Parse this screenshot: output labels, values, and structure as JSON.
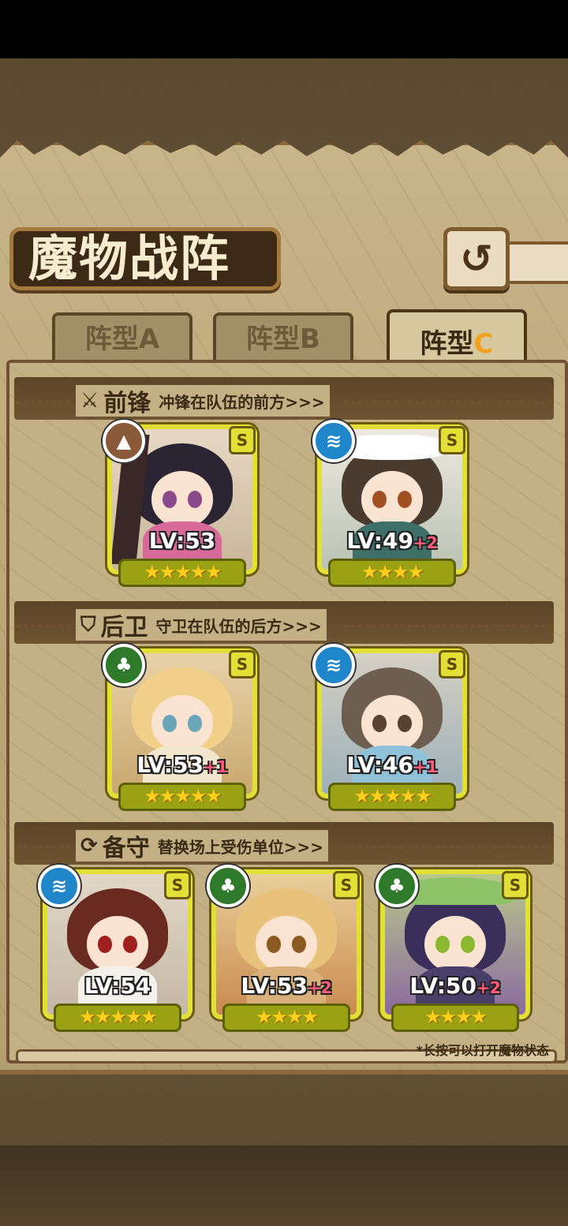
{
  "title": "魔物战阵",
  "back_icon": "↺",
  "tabs": [
    {
      "label": "阵型A",
      "active": false
    },
    {
      "label": "阵型B",
      "active": false
    },
    {
      "label": "阵型",
      "accent": "C",
      "active": true
    }
  ],
  "sections": {
    "front": {
      "name": "前锋",
      "desc": "冲锋在队伍的前方>>>",
      "icon": "sword-icon"
    },
    "back": {
      "name": "后卫",
      "desc": "守卫在队伍的后方>>>",
      "icon": "shield-icon"
    },
    "reserve": {
      "name": "备守",
      "desc": "替换场上受伤单位>>>",
      "icon": "swap-icon"
    }
  },
  "units": {
    "front1": {
      "lv": "LV:53",
      "bonus": "",
      "rank": "S",
      "element": "earth",
      "stars": "★★★★★",
      "elem_glyph": "▲"
    },
    "front2": {
      "lv": "LV:49",
      "bonus": "+2",
      "rank": "S",
      "element": "water",
      "stars": "★★★★",
      "elem_glyph": "≋"
    },
    "back1": {
      "lv": "LV:53",
      "bonus": "+1",
      "rank": "S",
      "element": "nature",
      "stars": "★★★★★",
      "elem_glyph": "♣"
    },
    "back2": {
      "lv": "LV:46",
      "bonus": "+1",
      "rank": "S",
      "element": "water",
      "stars": "★★★★★",
      "elem_glyph": "≋"
    },
    "res1": {
      "lv": "LV:54",
      "bonus": "",
      "rank": "S",
      "element": "water",
      "stars": "★★★★★",
      "elem_glyph": "≋"
    },
    "res2": {
      "lv": "LV:53",
      "bonus": "+2",
      "rank": "S",
      "element": "nature",
      "stars": "★★★★",
      "elem_glyph": "♣"
    },
    "res3": {
      "lv": "LV:50",
      "bonus": "+2",
      "rank": "S",
      "element": "nature",
      "stars": "★★★★",
      "elem_glyph": "♣"
    }
  },
  "hint": "*长按可以打开魔物状态",
  "colors": {
    "earth": "#8a5a3a",
    "water": "#1f86c9",
    "nature": "#2f7a2a",
    "card_border": "#e2df36"
  }
}
